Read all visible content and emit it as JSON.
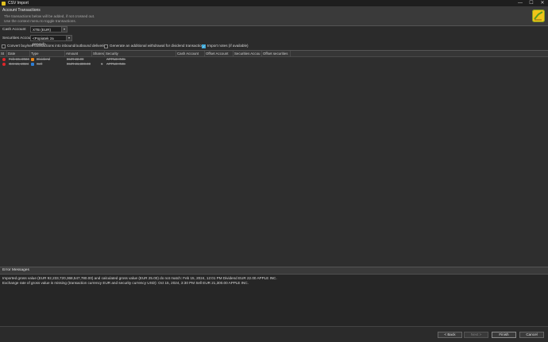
{
  "window": {
    "title": "CSV Import",
    "minimize": "—",
    "maximize": "☐",
    "close": "✕"
  },
  "header": {
    "title": "Account Transactions",
    "line1": "The transactions below will be added, if not crossed out.",
    "line2": "Use the context menu to toggle transactions."
  },
  "cash_account": {
    "label": "Cash Account",
    "value": "XTB (EUR)"
  },
  "securities_account": {
    "label": "Securities Account",
    "value": "<Popiatek za prevod>"
  },
  "options": [
    {
      "label": "Convert buy/sell transactions into inbound/outbound deliveries",
      "checked": false
    },
    {
      "label": "Generate an additional withdrawal for dividend transactions",
      "checked": false
    },
    {
      "label": "Import notes (if available)",
      "checked": true
    }
  ],
  "table": {
    "columns": [
      "St",
      "Date",
      "Type",
      "Amount",
      "Shares",
      "Security",
      "Cash Account",
      "Offset Account",
      "Securities Accou",
      "Offset securities"
    ],
    "rows": [
      {
        "date": "Feb 15, 2024",
        "type": "Dividend",
        "type_color": "#e8861a",
        "amount": "EUR 22.00",
        "shares": "",
        "security": "APPLE INC."
      },
      {
        "date": "Oct 15, 2024",
        "type": "Sell",
        "type_color": "#2f7fd6",
        "amount": "EUR 21,300.00",
        "shares": "1",
        "security": "APPLE INC."
      }
    ]
  },
  "errors": {
    "title": "Error Messages",
    "lines": [
      "Imported gross value (EUR 92,233,720,368,547,780.00) and calculated gross value (EUR 25.00) do not match: Feb 15, 2024, 12:01 PM Dividend EUR 22.00 APPLE INC.",
      "Exchange rate of gross value is missing (transaction currency EUR and security currency USD): Oct 15, 2024, 3:30 PM Sell EUR 21,300.00 APPLE INC."
    ]
  },
  "buttons": {
    "back": "< Back",
    "next": "Next >",
    "finish": "Finish",
    "cancel": "Cancel"
  },
  "colors": {
    "status_error": "#e0262a",
    "accent": "#3fa9d8"
  }
}
